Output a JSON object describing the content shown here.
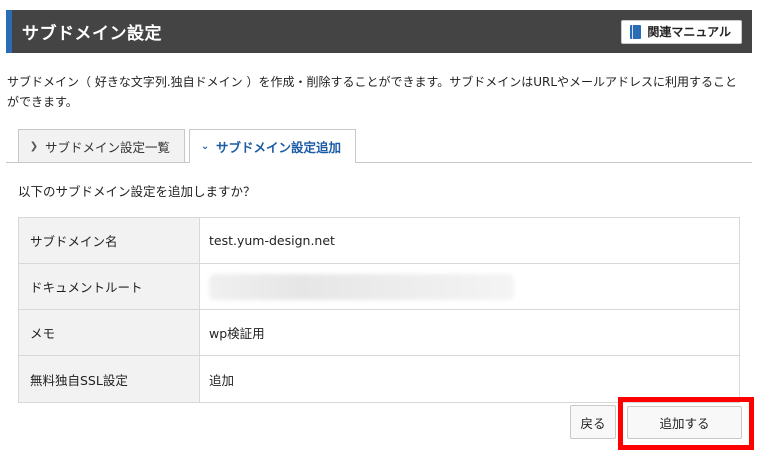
{
  "header": {
    "title": "サブドメイン設定",
    "manual_label": "関連マニュアル"
  },
  "description": "サブドメイン（ 好きな文字列.独自ドメイン ）を作成・削除することができます。サブドメインはURLやメールアドレスに利用することができます。",
  "tabs": [
    {
      "label": "サブドメイン設定一覧",
      "active": false
    },
    {
      "label": "サブドメイン設定追加",
      "active": true
    }
  ],
  "question": "以下のサブドメイン設定を追加しますか？",
  "table": [
    {
      "label": "サブドメイン名",
      "value": "test.yum-design.net"
    },
    {
      "label": "ドキュメントルート",
      "value": ""
    },
    {
      "label": "メモ",
      "value": "wp検証用"
    },
    {
      "label": "無料独自SSL設定",
      "value": "追加"
    }
  ],
  "buttons": {
    "back": "戻る",
    "add": "追加する"
  },
  "colors": {
    "header_bg": "#444444",
    "accent": "#2a6db5",
    "highlight": "#ff0000"
  }
}
